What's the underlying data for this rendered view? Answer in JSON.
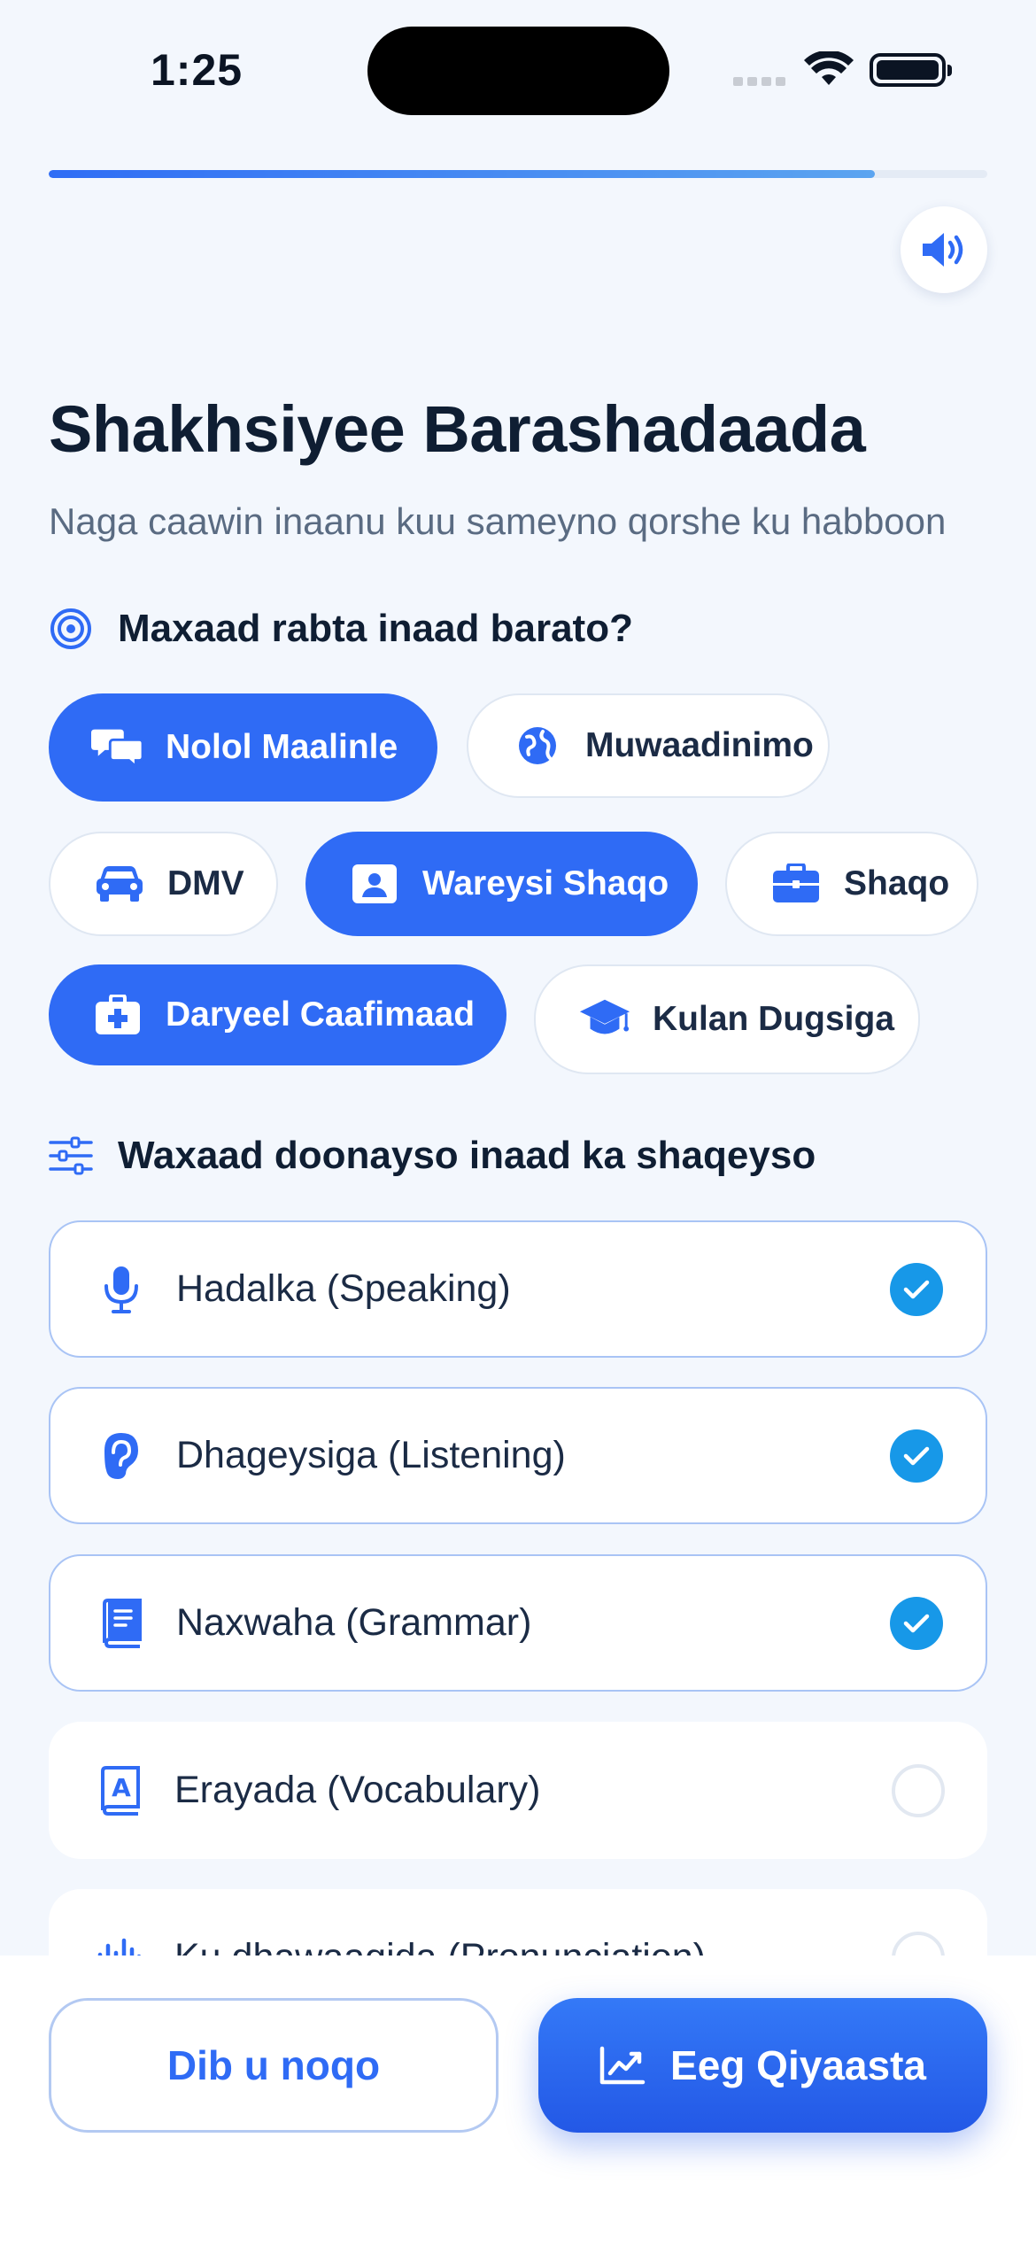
{
  "status": {
    "time": "1:25"
  },
  "progress": {
    "fraction": 0.88
  },
  "header": {
    "title": "Shakhsiyee Barashadaada",
    "subtitle": "Naga caawin inaanu kuu sameyno qorshe ku habboon"
  },
  "goals": {
    "heading": "Maxaad rabta inaad barato?",
    "options": [
      {
        "label": "Nolol Maalinle",
        "icon": "chat-bubbles-icon",
        "selected": true
      },
      {
        "label": "Muwaadinimo",
        "icon": "globe-icon",
        "selected": false
      },
      {
        "label": "DMV",
        "icon": "car-icon",
        "selected": false
      },
      {
        "label": "Wareysi Shaqo",
        "icon": "id-badge-icon",
        "selected": true
      },
      {
        "label": "Shaqo",
        "icon": "briefcase-icon",
        "selected": false
      },
      {
        "label": "Daryeel Caafimaad",
        "icon": "medical-kit-icon",
        "selected": true
      },
      {
        "label": "Kulan Dugsiga",
        "icon": "graduation-cap-icon",
        "selected": false
      }
    ]
  },
  "skills": {
    "heading": "Waxaad doonayso inaad ka shaqeyso",
    "items": [
      {
        "label": "Hadalka (Speaking)",
        "icon": "microphone-icon",
        "checked": true
      },
      {
        "label": "Dhageysiga (Listening)",
        "icon": "ear-icon",
        "checked": true
      },
      {
        "label": "Naxwaha (Grammar)",
        "icon": "book-icon",
        "checked": true
      },
      {
        "label": "Erayada (Vocabulary)",
        "icon": "dictionary-icon",
        "checked": false
      },
      {
        "label": "Ku dhawaaqida (Pronunciation)",
        "icon": "waveform-icon",
        "checked": false
      }
    ]
  },
  "footer": {
    "back_label": "Dib u noqo",
    "next_label": "Eeg Qiyaasta"
  },
  "colors": {
    "accent": "#2f6bf5",
    "check": "#1798e8",
    "background": "#f3f7fd",
    "text": "#0f1e33"
  }
}
